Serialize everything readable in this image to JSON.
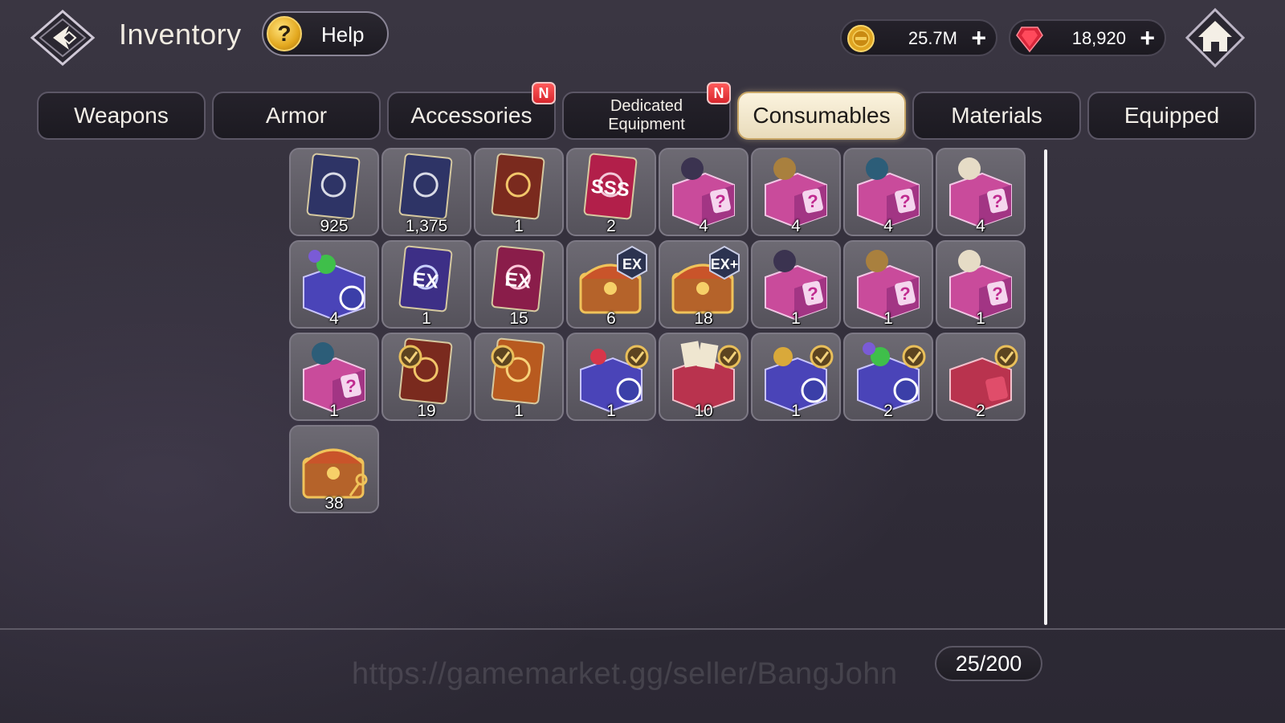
{
  "header": {
    "title": "Inventory",
    "help_label": "Help",
    "help_icon_glyph": "?",
    "gold": {
      "icon": "gold-coin-icon",
      "value": "25.7M",
      "plus": "+"
    },
    "gems": {
      "icon": "red-gem-icon",
      "value": "18,920",
      "plus": "+"
    }
  },
  "tabs": [
    {
      "label": "Weapons",
      "active": false,
      "badge": ""
    },
    {
      "label": "Armor",
      "active": false,
      "badge": ""
    },
    {
      "label": "Accessories",
      "active": false,
      "badge": "N"
    },
    {
      "label": "Dedicated Equipment",
      "active": false,
      "badge": "N"
    },
    {
      "label": "Consumables",
      "active": true,
      "badge": ""
    },
    {
      "label": "Materials",
      "active": false,
      "badge": ""
    },
    {
      "label": "Equipped",
      "active": false,
      "badge": ""
    }
  ],
  "items": [
    {
      "icon": "blue-star-card-2star-icon",
      "count": "925"
    },
    {
      "icon": "blue-star-card-3star-icon",
      "count": "1,375"
    },
    {
      "icon": "red-star-card-4star-icon",
      "count": "1"
    },
    {
      "icon": "sss-card-icon",
      "count": "2"
    },
    {
      "icon": "mystery-box-dark-warrior-icon",
      "count": "4"
    },
    {
      "icon": "mystery-box-golden-warrior-icon",
      "count": "4"
    },
    {
      "icon": "mystery-box-dragon-icon",
      "count": "4"
    },
    {
      "icon": "mystery-box-angel-icon",
      "count": "4"
    },
    {
      "icon": "selector-box-gems-icon",
      "count": "4"
    },
    {
      "icon": "ex-card-blue-icon",
      "count": "1"
    },
    {
      "icon": "ex-card-red-icon",
      "count": "15"
    },
    {
      "icon": "ex-chest-icon",
      "count": "6"
    },
    {
      "icon": "ex-plus-chest-icon",
      "count": "18"
    },
    {
      "icon": "mystery-box-dark-warrior-icon",
      "count": "1"
    },
    {
      "icon": "mystery-box-golden-warrior-icon",
      "count": "1"
    },
    {
      "icon": "mystery-box-angel-icon",
      "count": "1"
    },
    {
      "icon": "mystery-box-dragon-icon",
      "count": "1"
    },
    {
      "icon": "select-card-red-icon",
      "count": "19"
    },
    {
      "icon": "select-card-orange-icon",
      "count": "1"
    },
    {
      "icon": "select-box-flowers-icon",
      "count": "1"
    },
    {
      "icon": "select-box-cards-icon",
      "count": "10"
    },
    {
      "icon": "select-box-golden-icon",
      "count": "1"
    },
    {
      "icon": "select-box-gems-icon",
      "count": "2"
    },
    {
      "icon": "select-box-red-icon",
      "count": "2"
    },
    {
      "icon": "treasure-chest-key-icon",
      "count": "38"
    }
  ],
  "capacity": "25/200",
  "watermark": "https://gamemarket.gg/seller/BangJohn",
  "colors": {
    "accent": "#e9dcbc",
    "badge": "#d8262e",
    "background": "#34303c"
  }
}
